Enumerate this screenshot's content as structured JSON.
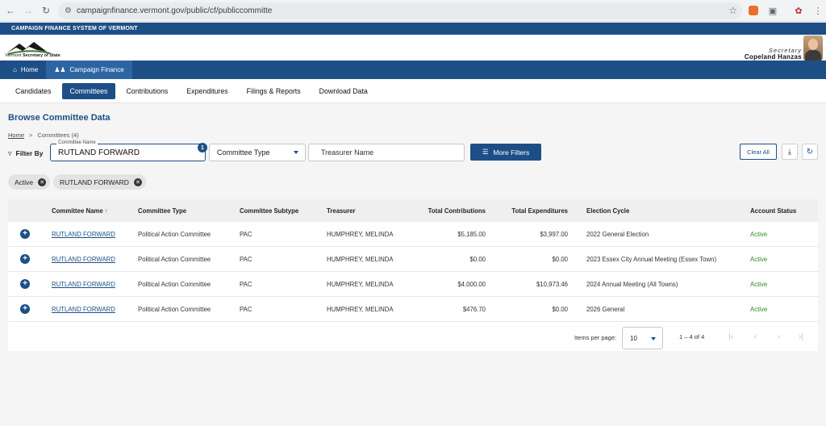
{
  "browser": {
    "url": "campaignfinance.vermont.gov/public/cf/publiccommitte"
  },
  "site": {
    "system_title": "CAMPAIGN FINANCE SYSTEM OF VERMONT",
    "logo_text_plain": "Vermont ",
    "logo_text_bold": "Secretary of State",
    "secretary_title": "Secretary",
    "secretary_name": "Copeland Hanzas"
  },
  "main_nav": [
    {
      "label": "Home",
      "icon": "home-icon"
    },
    {
      "label": "Campaign Finance",
      "icon": "people-icon"
    }
  ],
  "tabs": [
    {
      "label": "Candidates"
    },
    {
      "label": "Committees"
    },
    {
      "label": "Contributions"
    },
    {
      "label": "Expenditures"
    },
    {
      "label": "Filings & Reports"
    },
    {
      "label": "Download Data"
    }
  ],
  "page": {
    "title": "Browse Committee Data",
    "breadcrumb_home": "Home",
    "breadcrumb_sep": ">",
    "breadcrumb_current": "Committees (4)"
  },
  "filters": {
    "filter_by_label": "Filter By",
    "committee_name_label": "Committee Name",
    "committee_name_value": "RUTLAND FORWARD",
    "badge_count": "1",
    "committee_type_label": "Committee Type",
    "treasurer_placeholder": "Treasurer Name",
    "more_filters_label": "More Filters",
    "clear_all_label": "Clear All"
  },
  "chips": [
    {
      "label": "Active"
    },
    {
      "label": "RUTLAND FORWARD"
    }
  ],
  "table": {
    "columns": [
      "Committee Name",
      "Committee Type",
      "Committee Subtype",
      "Treasurer",
      "Total Contributions",
      "Total Expenditures",
      "Election Cycle",
      "Account Status"
    ],
    "sort_indicator": "↑",
    "rows": [
      {
        "name": "RUTLAND FORWARD",
        "type": "Political Action Committee",
        "subtype": "PAC",
        "treasurer": "HUMPHREY, MELINDA",
        "contributions": "$5,185.00",
        "expenditures": "$3,997.00",
        "cycle": "2022 General Election",
        "status": "Active"
      },
      {
        "name": "RUTLAND FORWARD",
        "type": "Political Action Committee",
        "subtype": "PAC",
        "treasurer": "HUMPHREY, MELINDA",
        "contributions": "$0.00",
        "expenditures": "$0.00",
        "cycle": "2023 Essex City Annual Meeting (Essex Town)",
        "status": "Active"
      },
      {
        "name": "RUTLAND FORWARD",
        "type": "Political Action Committee",
        "subtype": "PAC",
        "treasurer": "HUMPHREY, MELINDA",
        "contributions": "$4,000.00",
        "expenditures": "$10,973.46",
        "cycle": "2024 Annual Meeting (All Towns)",
        "status": "Active"
      },
      {
        "name": "RUTLAND FORWARD",
        "type": "Political Action Committee",
        "subtype": "PAC",
        "treasurer": "HUMPHREY, MELINDA",
        "contributions": "$476.70",
        "expenditures": "$0.00",
        "cycle": "2026 General",
        "status": "Active"
      }
    ]
  },
  "pagination": {
    "items_per_page_label": "Items per page:",
    "items_per_page_value": "10",
    "range": "1 – 4 of 4"
  },
  "colors": {
    "brand": "#1d4f86",
    "active_status": "#2e8b2e"
  }
}
